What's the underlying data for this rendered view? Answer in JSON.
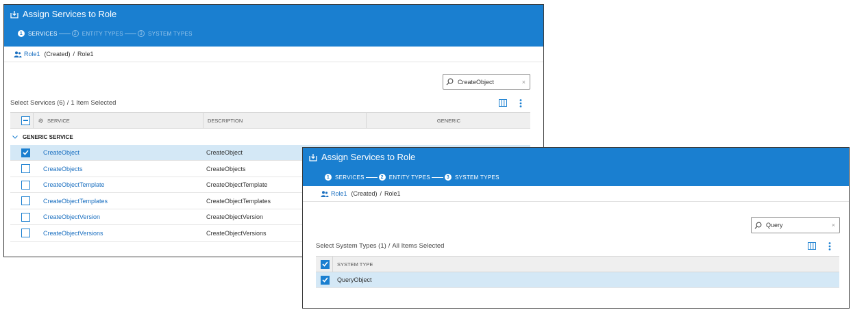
{
  "panel1": {
    "title": "Assign Services to Role",
    "steps": [
      {
        "num": "1",
        "label": "SERVICES"
      },
      {
        "num": "2",
        "label": "ENTITY TYPES"
      },
      {
        "num": "3",
        "label": "SYSTEM TYPES"
      }
    ],
    "breadcrumb": {
      "link": "Role1",
      "status": "(Created)",
      "sep": "/",
      "current": "Role1"
    },
    "search": {
      "value": "CreateObject",
      "clear": "×"
    },
    "selection": {
      "label": "Select Services (6)",
      "sep": "/",
      "summary": "1 Item Selected"
    },
    "columns": {
      "service": "SERVICE",
      "description": "DESCRIPTION",
      "generic": "GENERIC"
    },
    "group": "GENERIC SERVICE",
    "rows": [
      {
        "service": "CreateObject",
        "description": "CreateObject",
        "checked": true
      },
      {
        "service": "CreateObjects",
        "description": "CreateObjects",
        "checked": false
      },
      {
        "service": "CreateObjectTemplate",
        "description": "CreateObjectTemplate",
        "checked": false
      },
      {
        "service": "CreateObjectTemplates",
        "description": "CreateObjectTemplates",
        "checked": false
      },
      {
        "service": "CreateObjectVersion",
        "description": "CreateObjectVersion",
        "checked": false
      },
      {
        "service": "CreateObjectVersions",
        "description": "CreateObjectVersions",
        "checked": false
      }
    ]
  },
  "panel2": {
    "title": "Assign Services to Role",
    "steps": [
      {
        "num": "1",
        "label": "SERVICES"
      },
      {
        "num": "2",
        "label": "ENTITY TYPES"
      },
      {
        "num": "3",
        "label": "SYSTEM TYPES"
      }
    ],
    "breadcrumb": {
      "link": "Role1",
      "status": "(Created)",
      "sep": "/",
      "current": "Role1"
    },
    "search": {
      "value": "Query",
      "clear": "×"
    },
    "selection": {
      "label": "Select System Types (1)",
      "sep": "/",
      "summary": "All Items Selected"
    },
    "columns": {
      "system_type": "SYSTEM TYPE"
    },
    "rows": [
      {
        "system_type": "QueryObject",
        "checked": true
      }
    ]
  },
  "icons": {
    "title": "download-box-icon",
    "breadcrumb": "users-icon",
    "search": "magnifier-icon",
    "columns": "columns-icon",
    "menu": "kebab-menu-icon",
    "service_column": "gear-icon",
    "group": "chevron-down-icon"
  },
  "colors": {
    "header": "#1a7fd0",
    "selected_row": "#d4e8f6",
    "link": "#1a6fc0"
  }
}
